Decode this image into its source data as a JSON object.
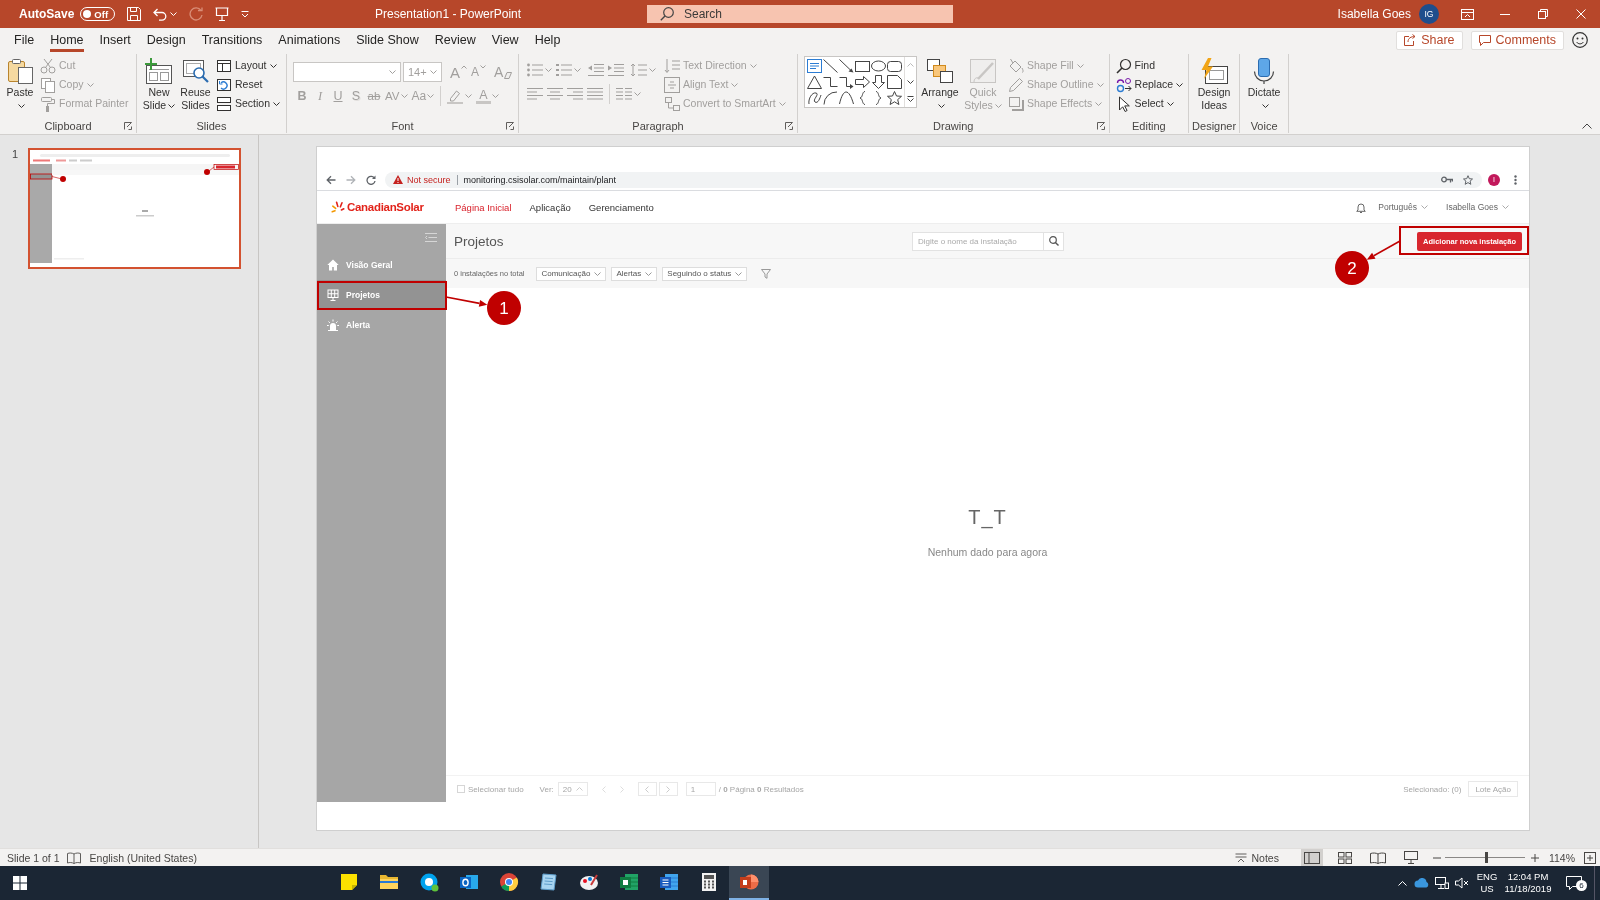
{
  "title_bar": {
    "autosave_label": "AutoSave",
    "autosave_on": false,
    "autosave_state": "Off",
    "title": "Presentation1 - PowerPoint",
    "search": {
      "placeholder": "Search"
    },
    "user_name": "Isabella Goes",
    "user_initials": "IG"
  },
  "ribbon_tabs": [
    {
      "label": "File",
      "selected": false
    },
    {
      "label": "Home",
      "selected": true
    },
    {
      "label": "Insert",
      "selected": false
    },
    {
      "label": "Design",
      "selected": false
    },
    {
      "label": "Transitions",
      "selected": false
    },
    {
      "label": "Animations",
      "selected": false
    },
    {
      "label": "Slide Show",
      "selected": false
    },
    {
      "label": "Review",
      "selected": false
    },
    {
      "label": "View",
      "selected": false
    },
    {
      "label": "Help",
      "selected": false
    }
  ],
  "ribbon_actions": {
    "share": "Share",
    "comments": "Comments"
  },
  "ribbon_groups": [
    {
      "kind": "clipboard",
      "label": "Clipboard",
      "items": [
        {
          "kind": "paste",
          "label": "Paste",
          "disabled": false
        },
        {
          "kind": "cut",
          "label": "Cut",
          "disabled": true
        },
        {
          "kind": "copy",
          "label": "Copy",
          "disabled": true
        },
        {
          "kind": "format_painter",
          "label": "Format Painter",
          "disabled": true
        }
      ]
    },
    {
      "kind": "slides",
      "label": "Slides",
      "items": [
        {
          "kind": "new_slide",
          "label": "New Slide",
          "disabled": false
        },
        {
          "kind": "reuse_slides",
          "label": "Reuse Slides",
          "disabled": false
        },
        {
          "kind": "layout",
          "label": "Layout",
          "disabled": false
        },
        {
          "kind": "reset",
          "label": "Reset",
          "disabled": false
        },
        {
          "kind": "section",
          "label": "Section",
          "disabled": false
        }
      ]
    },
    {
      "kind": "font",
      "label": "Font",
      "items": [
        {
          "kind": "font_name",
          "disabled": true
        },
        {
          "kind": "font_size",
          "value": "14+",
          "disabled": true
        },
        {
          "kind": "grow",
          "label": "A",
          "disabled": true
        },
        {
          "kind": "shrink",
          "label": "A",
          "disabled": true
        },
        {
          "kind": "clear",
          "label": "A",
          "disabled": true
        },
        {
          "kind": "bold",
          "label": "B",
          "disabled": true
        },
        {
          "kind": "italic",
          "label": "I",
          "disabled": true
        },
        {
          "kind": "underline",
          "label": "U",
          "disabled": true
        },
        {
          "kind": "shadow",
          "label": "S",
          "disabled": true
        },
        {
          "kind": "strike",
          "label": "ab",
          "disabled": true
        },
        {
          "kind": "spacing",
          "label": "AV",
          "disabled": true
        },
        {
          "kind": "case",
          "label": "Aa",
          "disabled": true
        },
        {
          "kind": "highlight",
          "disabled": true
        },
        {
          "kind": "color",
          "label": "A",
          "disabled": true
        }
      ]
    },
    {
      "kind": "paragraph",
      "label": "Paragraph",
      "items": [
        {
          "kind": "bullets",
          "disabled": true
        },
        {
          "kind": "numbering",
          "disabled": true
        },
        {
          "kind": "outdent",
          "disabled": true
        },
        {
          "kind": "indent",
          "disabled": true
        },
        {
          "kind": "line_spacing",
          "disabled": true
        },
        {
          "kind": "align_left",
          "disabled": true
        },
        {
          "kind": "align_center",
          "disabled": true
        },
        {
          "kind": "align_right",
          "disabled": true
        },
        {
          "kind": "justify",
          "disabled": true
        },
        {
          "kind": "columns",
          "disabled": true
        },
        {
          "kind": "text_direction",
          "label": "Text Direction",
          "disabled": true
        },
        {
          "kind": "align_text",
          "label": "Align Text",
          "disabled": true
        },
        {
          "kind": "smartart",
          "label": "Convert to SmartArt",
          "disabled": true
        }
      ]
    },
    {
      "kind": "drawing",
      "label": "Drawing",
      "items": [
        {
          "kind": "shapes",
          "disabled": false
        },
        {
          "kind": "arrange",
          "label": "Arrange",
          "disabled": false
        },
        {
          "kind": "quick_styles",
          "label": "Quick Styles",
          "disabled": true
        },
        {
          "kind": "shape_fill",
          "label": "Shape Fill",
          "disabled": true
        },
        {
          "kind": "shape_outline",
          "label": "Shape Outline",
          "disabled": true
        },
        {
          "kind": "shape_effects",
          "label": "Shape Effects",
          "disabled": true
        }
      ]
    },
    {
      "kind": "editing",
      "label": "Editing",
      "items": [
        {
          "kind": "find",
          "label": "Find",
          "disabled": false
        },
        {
          "kind": "replace",
          "label": "Replace",
          "disabled": false
        },
        {
          "kind": "select",
          "label": "Select",
          "disabled": false
        }
      ]
    },
    {
      "kind": "designer",
      "label": "Designer",
      "items": [
        {
          "kind": "design_ideas",
          "label": "Design Ideas",
          "disabled": false
        }
      ]
    },
    {
      "kind": "voice",
      "label": "Voice",
      "items": [
        {
          "kind": "dictate",
          "label": "Dictate",
          "disabled": false
        }
      ]
    }
  ],
  "slides_pane": {
    "slides": [
      {
        "number": "1",
        "selected": true
      }
    ]
  },
  "slide": {
    "browser": {
      "security_label": "Not secure",
      "url": "monitoring.csisolar.com/maintain/plant",
      "profile_initial": "I"
    },
    "site_header": {
      "logo_text": "CanadianSolar",
      "nav": [
        {
          "label": "Página Inicial",
          "selected": true
        },
        {
          "label": "Aplicação",
          "selected": false
        },
        {
          "label": "Gerenciamento",
          "selected": false
        }
      ],
      "language": "Português",
      "user_name": "Isabella Goes"
    },
    "sidebar": {
      "items": [
        {
          "kind": "home",
          "label": "Visão Geral",
          "selected": false
        },
        {
          "kind": "grid",
          "label": "Projetos",
          "selected": true
        },
        {
          "kind": "alarm",
          "label": "Alerta",
          "selected": false
        }
      ]
    },
    "page": {
      "title": "Projetos",
      "search": {
        "placeholder": "Digite o nome da instalação"
      },
      "add_button": "Adicionar nova instalação",
      "total": "0 instalações no total",
      "filters": [
        {
          "label": "Comunicação"
        },
        {
          "label": "Alertas"
        },
        {
          "label": "Seguindo o status"
        }
      ],
      "empty_face": "T_T",
      "empty_message": "Nenhum dado para agora"
    },
    "footer": {
      "select_all_checked": false,
      "select_all": "Selecionar tudo",
      "per_page_label": "Ver:",
      "per_page": "20",
      "page_input": "1",
      "page_info": "/ **0** Página **0** Resultados",
      "selected_info": "Selecionado: (0)",
      "batch_button": "Lote Ação"
    },
    "annotations": [
      {
        "number": "1"
      },
      {
        "number": "2"
      }
    ]
  },
  "status_bar": {
    "slide_counter": "Slide 1 of 1",
    "language": "English (United States)",
    "notes": "Notes",
    "views": [
      {
        "kind": "normal",
        "selected": true
      },
      {
        "kind": "sorter",
        "selected": false
      },
      {
        "kind": "reading",
        "selected": false
      },
      {
        "kind": "slideshow",
        "selected": false
      }
    ],
    "zoom": {
      "label": "114%",
      "level": 0.52
    }
  },
  "taskbar": {
    "apps": [
      {
        "kind": "notes",
        "active": false
      },
      {
        "kind": "folder",
        "active": false
      },
      {
        "kind": "chat",
        "active": false
      },
      {
        "kind": "mail",
        "active": false
      },
      {
        "kind": "browser",
        "active": false
      },
      {
        "kind": "reader",
        "active": false
      },
      {
        "kind": "paint",
        "active": false
      },
      {
        "kind": "sheet",
        "active": false
      },
      {
        "kind": "document",
        "active": false
      },
      {
        "kind": "calculator",
        "active": false
      },
      {
        "kind": "presentation",
        "active": true
      }
    ],
    "tray": {
      "language": "ENG",
      "region": "US",
      "time": "12:04 PM",
      "date": "11/18/2019",
      "notifications": "6"
    }
  }
}
